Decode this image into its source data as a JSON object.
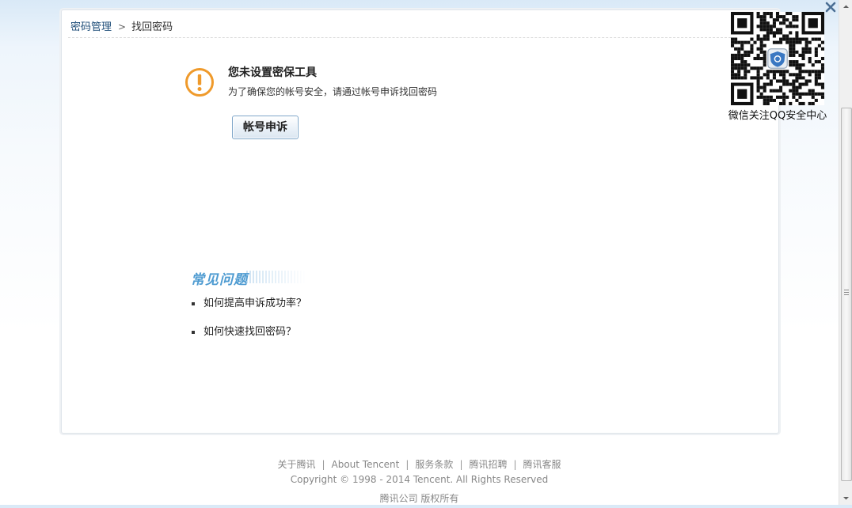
{
  "breadcrumb": {
    "root": "密码管理",
    "separator": ">",
    "current": "找回密码"
  },
  "notice": {
    "icon": "warning-exclamation-icon",
    "title": "您未设置密保工具",
    "description": "为了确保您的帐号安全，请通过帐号申诉找回密码",
    "button_label": "帐号申诉"
  },
  "faq": {
    "title": "常见问题",
    "items": [
      "如何提高申诉成功率？",
      "如何快速找回密码？"
    ]
  },
  "qr": {
    "caption": "微信关注QQ安全中心",
    "icon": "qr-code-icon"
  },
  "close_icon": "close-icon",
  "footer": {
    "links": [
      "关于腾讯",
      "About Tencent",
      "服务条款",
      "腾讯招聘",
      "腾讯客服"
    ],
    "separator": "|",
    "copyright": "Copyright © 1998 - 2014 Tencent. All Rights Reserved",
    "company": "腾讯公司 版权所有"
  },
  "colors": {
    "accent": "#1f4e79",
    "warning": "#f0a030",
    "faq_title": "#4e9bd1"
  }
}
